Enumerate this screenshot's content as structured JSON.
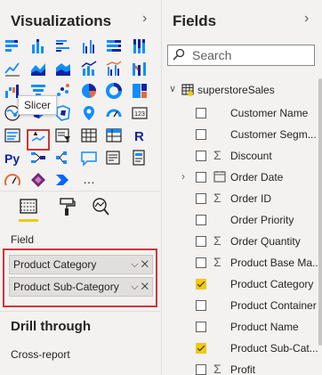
{
  "visualizations": {
    "title": "Visualizations",
    "collapse_icon": "chevron-right-icon",
    "tooltip": "Slicer",
    "tabs": [
      "fields-wells-icon",
      "format-paint-icon",
      "analytics-icon"
    ],
    "field_label": "Field",
    "wells": [
      {
        "label": "Product Category"
      },
      {
        "label": "Product Sub-Category"
      }
    ],
    "drill_through": "Drill through",
    "cross_report": "Cross-report",
    "more": "..."
  },
  "fields": {
    "title": "Fields",
    "collapse_icon": "chevron-right-icon",
    "search_placeholder": "Search",
    "table_name": "superstoreSales",
    "items": [
      {
        "name": "Customer Name",
        "icon": "",
        "checked": false,
        "expandable": false
      },
      {
        "name": "Customer Segm...",
        "icon": "",
        "checked": false,
        "expandable": false
      },
      {
        "name": "Discount",
        "icon": "sigma-icon",
        "checked": false,
        "expandable": false
      },
      {
        "name": "Order Date",
        "icon": "calendar-icon",
        "checked": false,
        "expandable": true
      },
      {
        "name": "Order ID",
        "icon": "sigma-icon",
        "checked": false,
        "expandable": false
      },
      {
        "name": "Order Priority",
        "icon": "",
        "checked": false,
        "expandable": false
      },
      {
        "name": "Order Quantity",
        "icon": "sigma-icon",
        "checked": false,
        "expandable": false
      },
      {
        "name": "Product Base Ma...",
        "icon": "sigma-icon",
        "checked": false,
        "expandable": false
      },
      {
        "name": "Product Category",
        "icon": "",
        "checked": true,
        "expandable": false
      },
      {
        "name": "Product Container",
        "icon": "",
        "checked": false,
        "expandable": false
      },
      {
        "name": "Product Name",
        "icon": "",
        "checked": false,
        "expandable": false
      },
      {
        "name": "Product Sub-Cat...",
        "icon": "",
        "checked": true,
        "expandable": false
      },
      {
        "name": "Profit",
        "icon": "sigma-icon",
        "checked": false,
        "expandable": false
      }
    ]
  },
  "colors": {
    "accent": "#f2c811",
    "highlight": "#d13438",
    "chart_blue": "#118dff",
    "chart_navy": "#12239e",
    "chart_orange": "#e66c37"
  }
}
